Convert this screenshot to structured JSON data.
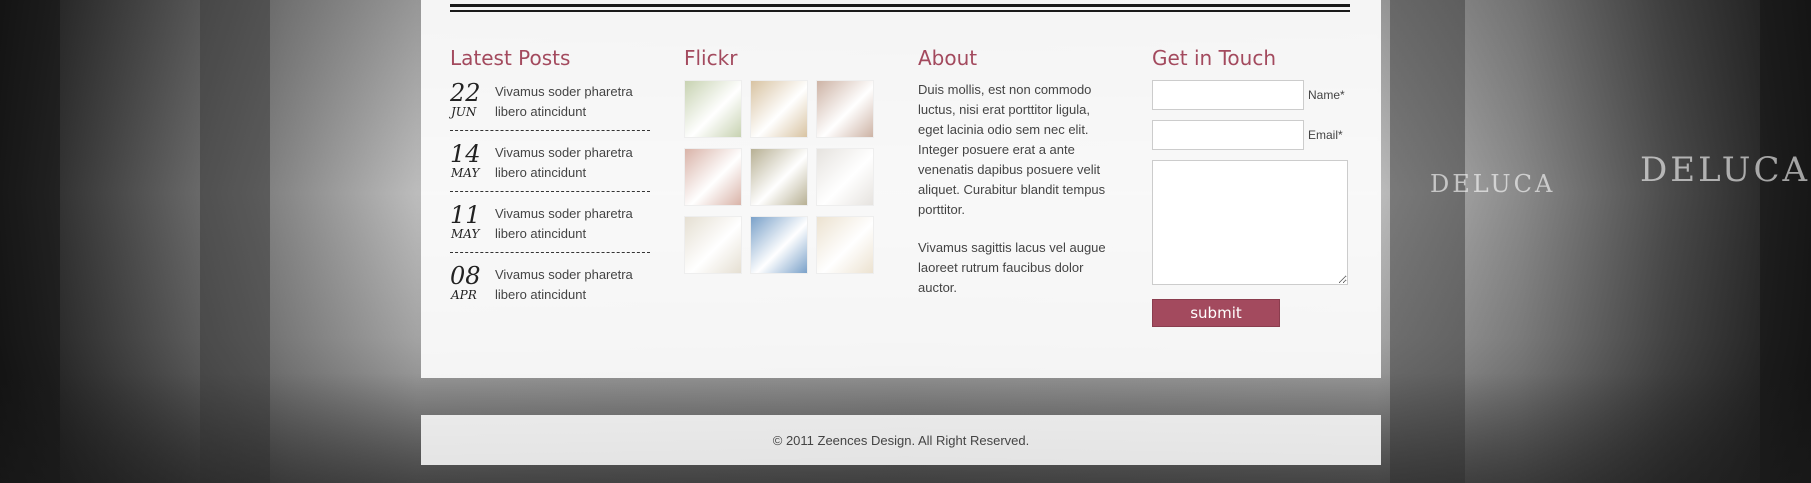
{
  "latest_posts": {
    "title": "Latest Posts",
    "items": [
      {
        "day": "22",
        "month": "JUN",
        "text": "Vivamus soder pharetra libero atincidunt"
      },
      {
        "day": "14",
        "month": "MAY",
        "text": "Vivamus soder pharetra libero atincidunt"
      },
      {
        "day": "11",
        "month": "MAY",
        "text": "Vivamus soder pharetra libero atincidunt"
      },
      {
        "day": "08",
        "month": "APR",
        "text": "Vivamus soder pharetra libero atincidunt"
      }
    ]
  },
  "flickr": {
    "title": "Flickr",
    "photos": [
      "#c7d2b1",
      "#d8c3a2",
      "#cdb3a5",
      "#d9b3a8",
      "#b7b094",
      "#e6e3df",
      "#e5dfd2",
      "#7aa1c9",
      "#ece2d0"
    ]
  },
  "about": {
    "title": "About",
    "p1": "Duis mollis, est non commodo luctus, nisi erat porttitor ligula, eget lacinia odio sem nec elit. Integer posuere erat a ante venenatis dapibus posuere velit aliquet. Curabitur blandit tempus porttitor.",
    "p2": "Vivamus sagittis lacus vel augue laoreet rutrum faucibus dolor auctor."
  },
  "contact": {
    "title": "Get in Touch",
    "name_label": "Name*",
    "email_label": "Email*",
    "name_value": "",
    "email_value": "",
    "message_value": "",
    "submit_label": "submit"
  },
  "footer": {
    "copyright": "© 2011 Zeences Design. All Right Reserved."
  },
  "background": {
    "sign": "DELUCA",
    "accent": "#a34a5e"
  }
}
